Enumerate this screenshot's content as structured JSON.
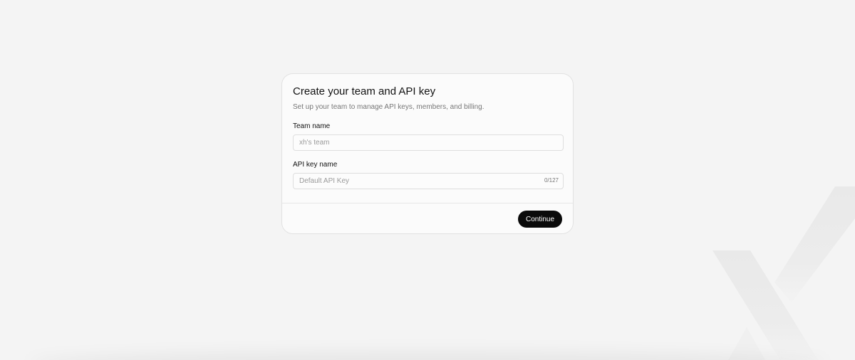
{
  "card": {
    "title": "Create your team and API key",
    "subtitle": "Set up your team to manage API keys, members, and billing."
  },
  "fields": {
    "team_name": {
      "label": "Team name",
      "placeholder": "xh's team",
      "value": ""
    },
    "api_key_name": {
      "label": "API key name",
      "placeholder": "Default API Key",
      "value": "",
      "counter": "0/127"
    }
  },
  "actions": {
    "continue_label": "Continue"
  },
  "background": {
    "logo_icon": "x-logo-watermark-icon"
  },
  "colors": {
    "page_background": "#f4f4f4",
    "card_background": "#fbfbfb",
    "primary_button": "#0a0a0a"
  }
}
